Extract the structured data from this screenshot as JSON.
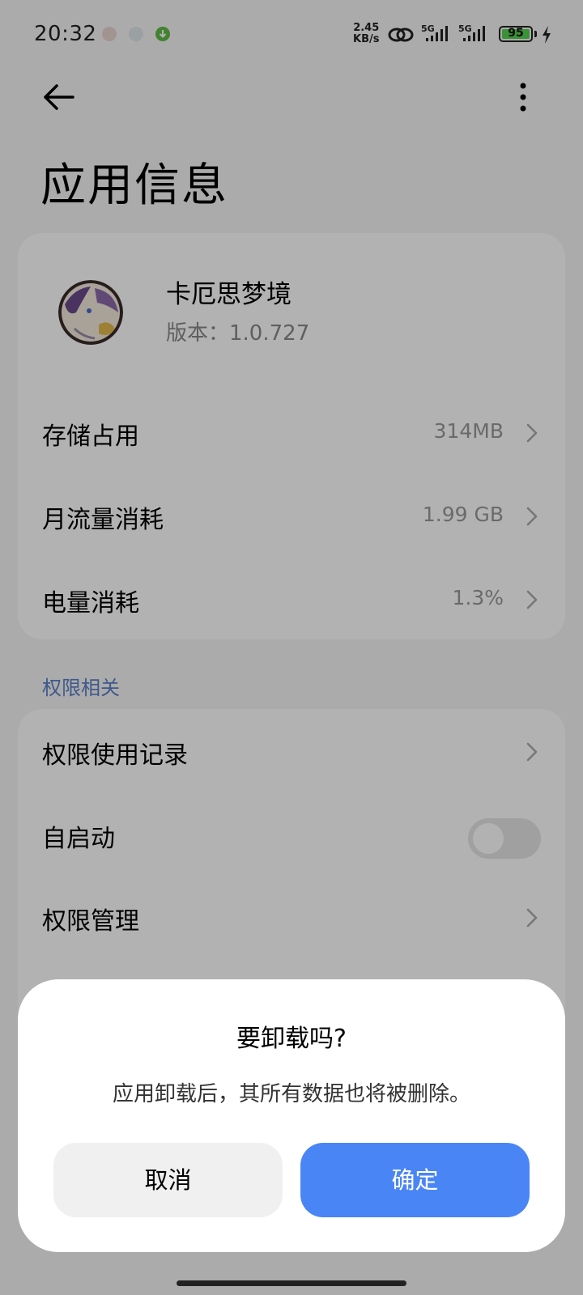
{
  "status_bar": {
    "time": "20:32",
    "net_speed_value": "2.45",
    "net_speed_unit": "KB/s",
    "signal1_label": "5G",
    "signal2_label": "5G",
    "battery_level": "95"
  },
  "header": {
    "title": "应用信息"
  },
  "app": {
    "name": "卡厄思梦境",
    "version": "版本：1.0.727"
  },
  "usage_rows": [
    {
      "label": "存储占用",
      "value": "314MB"
    },
    {
      "label": "月流量消耗",
      "value": "1.99 GB"
    },
    {
      "label": "电量消耗",
      "value": "1.3%"
    }
  ],
  "permissions": {
    "section_label": "权限相关",
    "rows": [
      {
        "label": "权限使用记录"
      },
      {
        "label": "自启动",
        "toggle": false
      },
      {
        "label": "权限管理"
      }
    ]
  },
  "dialog": {
    "title": "要卸载吗?",
    "message": "应用卸载后，其所有数据也将被删除。",
    "cancel_label": "取消",
    "confirm_label": "确定"
  },
  "colors": {
    "accent": "#4a85f5",
    "section_label": "#5a7ec8",
    "battery": "#52d14c"
  }
}
